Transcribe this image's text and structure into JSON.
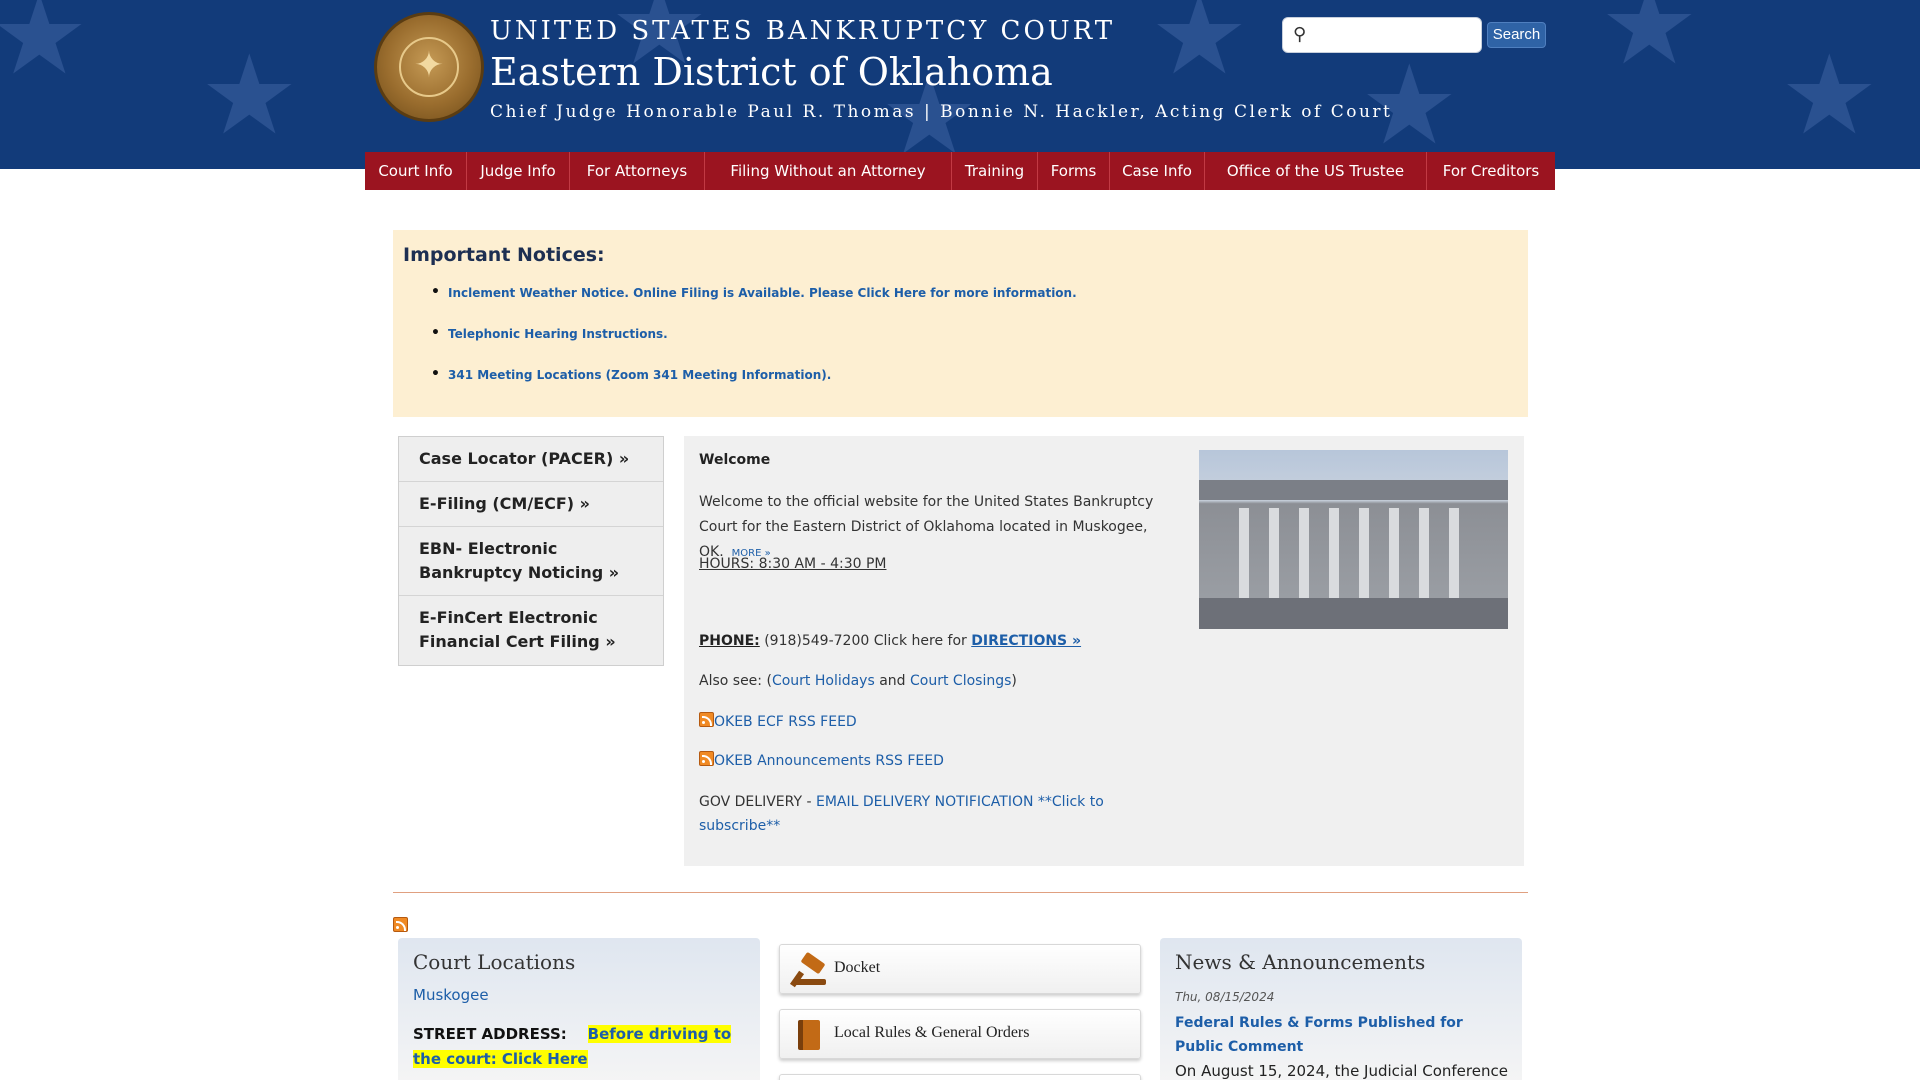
{
  "header": {
    "court": "UNITED STATES BANKRUPTCY COURT",
    "district": "Eastern District of Oklahoma",
    "judges": "Chief Judge Honorable Paul R. Thomas | Bonnie N. Hackler, Acting Clerk of Court",
    "search_button": "Search",
    "search_placeholder": ""
  },
  "nav": [
    "Court Info",
    "Judge Info",
    "For Attorneys",
    "Filing Without an Attorney",
    "Training",
    "Forms",
    "Case Info",
    "Office of the US Trustee",
    "For Creditors"
  ],
  "notices": {
    "title": "Important Notices:",
    "items": [
      "Inclement Weather Notice. Online Filing is Available. Please Click Here for more information.",
      "Telephonic Hearing Instructions.",
      "341 Meeting Locations (Zoom 341 Meeting Information)."
    ]
  },
  "leftmenu": [
    "Case Locator (PACER) »",
    "E-Filing (CM/ECF) »",
    "EBN- Electronic Bankruptcy Noticing »",
    "E-FinCert Electronic Financial Cert Filing »"
  ],
  "welcome": {
    "title": "Welcome",
    "text": "Welcome to the official website for the United States Bankruptcy Court for the Eastern District of Oklahoma located in Muskogee, OK.",
    "more": "MORE »",
    "hours": "HOURS: 8:30 AM - 4:30 PM",
    "phone_label": "PHONE:",
    "phone_text": " (918)549-7200 Click here for ",
    "directions": "DIRECTIONS »",
    "also_prefix": "Also see:  (",
    "holidays": "Court Holidays",
    "and": " and ",
    "closings": "Court Closings",
    "also_suffix": ")",
    "rss1": "OKEB ECF RSS FEED",
    "rss2": "OKEB Announcements RSS FEED",
    "gov_prefix": "GOV DELIVERY - ",
    "gov_link": "EMAIL DELIVERY NOTIFICATION   **Click to subscribe**"
  },
  "locations": {
    "title": "Court Locations",
    "city": "Muskogee",
    "street_label": "STREET ADDRESS:",
    "highlight": "Before driving to the court: Click Here"
  },
  "quicklinks": [
    "Docket",
    "Local Rules & General Orders",
    ""
  ],
  "news": {
    "title": "News & Announcements",
    "date": "Thu, 08/15/2024",
    "headline": "Federal Rules & Forms Published for Public Comment",
    "body": "On August 15, 2024, the Judicial Conference"
  },
  "colors": {
    "header_bg": "#123b7a",
    "nav_bg": "#9b1420",
    "notice_bg": "#fdefd2",
    "link": "#1d5ea8"
  }
}
